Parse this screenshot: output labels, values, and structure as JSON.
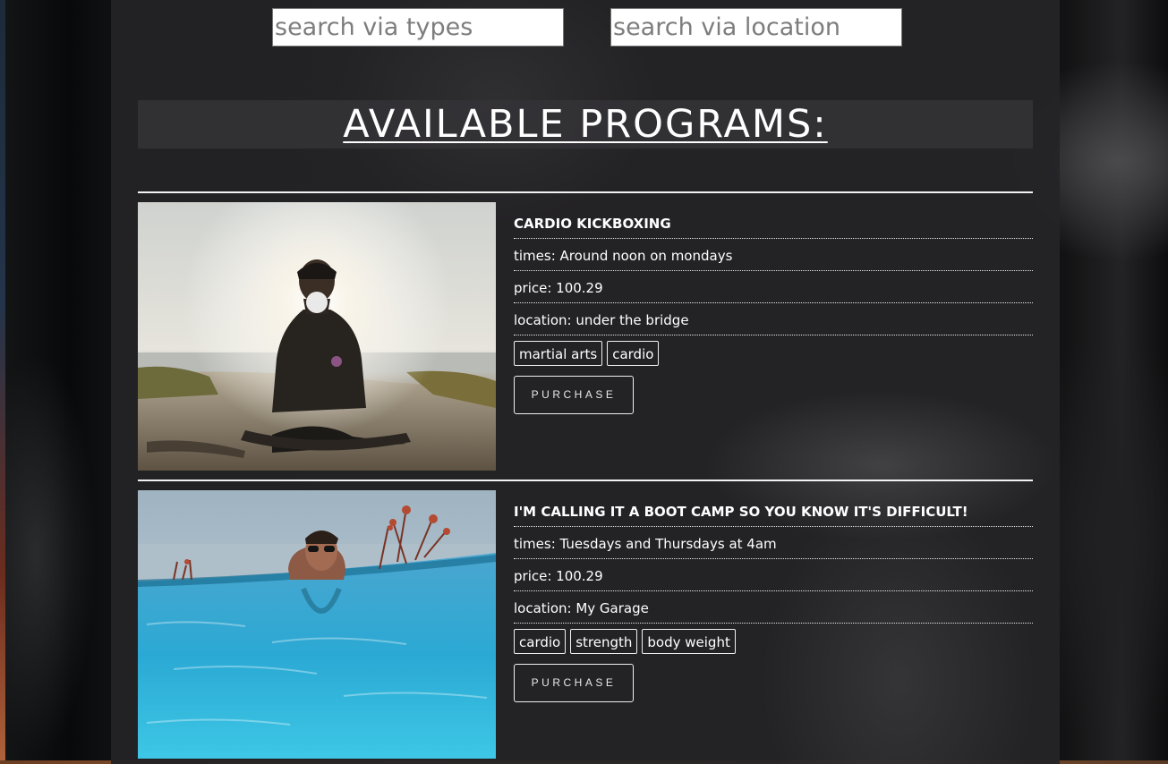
{
  "search": {
    "types_placeholder": "search via types",
    "location_placeholder": "search via location"
  },
  "heading": "AVAILABLE PROGRAMS:",
  "programs": [
    {
      "name": "CARDIO KICKBOXING",
      "times": "times: Around noon on mondays",
      "price": "price: 100.29",
      "location": "location: under the bridge",
      "tags": [
        "martial arts",
        "cardio"
      ],
      "purchase_label": "PURCHASE"
    },
    {
      "name": "I'M CALLING IT A BOOT CAMP SO YOU KNOW IT'S DIFFICULT!",
      "times": "times: Tuesdays and Thursdays at 4am",
      "price": "price: 100.29",
      "location": "location: My Garage",
      "tags": [
        "cardio",
        "strength",
        "body weight"
      ],
      "purchase_label": "PURCHASE"
    }
  ]
}
